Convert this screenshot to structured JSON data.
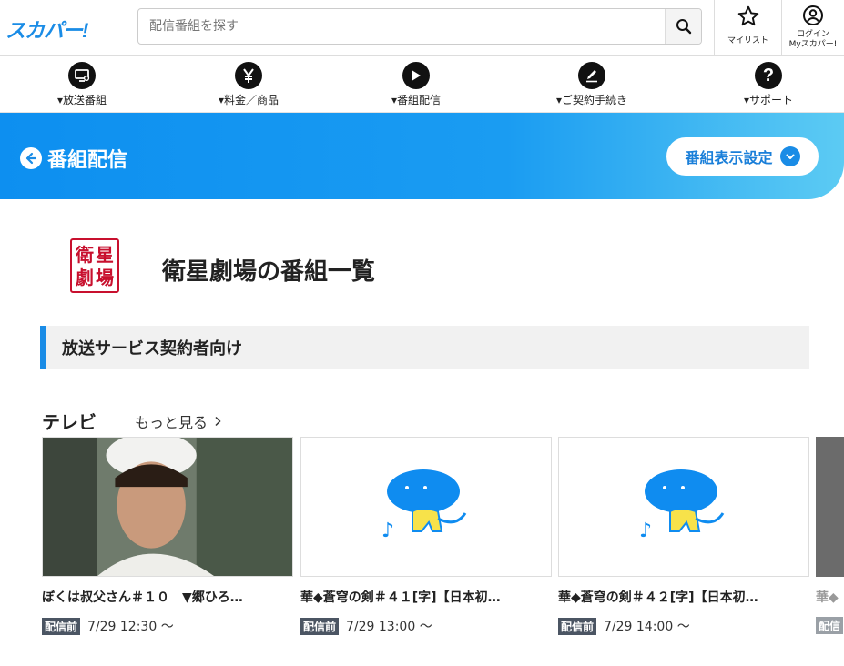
{
  "header": {
    "logo": "スカパー!",
    "search_placeholder": "配信番組を探す",
    "mylist_label": "マイリスト",
    "login_label1": "ログイン",
    "login_label2": "Myスカパー!"
  },
  "nav": {
    "items": [
      {
        "label": "▾放送番組",
        "icon": "tv-icon"
      },
      {
        "label": "▾料金／商品",
        "icon": "yen-icon"
      },
      {
        "label": "▾番組配信",
        "icon": "play-icon"
      },
      {
        "label": "▾ご契約手続き",
        "icon": "pen-icon"
      },
      {
        "label": "▾サポート",
        "icon": "question-icon"
      }
    ]
  },
  "banner": {
    "title": "番組配信",
    "settings_label": "番組表示設定"
  },
  "channel": {
    "logo_chars": [
      "衛",
      "星",
      "劇",
      "場"
    ],
    "title": "衛星劇場の番組一覧"
  },
  "section": {
    "title": "放送サービス契約者向け"
  },
  "tv": {
    "heading": "テレビ",
    "more_label": "もっと見る",
    "cards": [
      {
        "title": "ぼくは叔父さん＃１０　▼郷ひろ…",
        "badge": "配信前",
        "time": "7/29 12:30 〜",
        "thumb": "photo"
      },
      {
        "title": "華◆蒼穹の剣＃４１[字]【日本初…",
        "badge": "配信前",
        "time": "7/29 13:00 〜",
        "thumb": "mascot"
      },
      {
        "title": "華◆蒼穹の剣＃４２[字]【日本初…",
        "badge": "配信前",
        "time": "7/29 14:00 〜",
        "thumb": "mascot"
      },
      {
        "title": "華◆",
        "badge": "配信",
        "time": "",
        "thumb": "gray"
      }
    ]
  },
  "colors": {
    "brand_blue": "#1a8ce6",
    "channel_red": "#c8102e",
    "badge_gray": "#4b5563"
  }
}
